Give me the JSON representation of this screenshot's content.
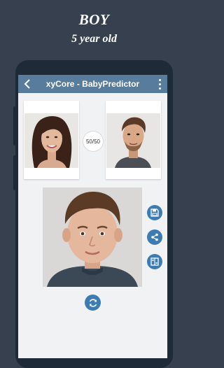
{
  "promo": {
    "title": "BOY",
    "subtitle": "5 year old"
  },
  "app_bar": {
    "title": "xyCore - BabyPredictor",
    "back_icon": "arrow-back-icon",
    "menu_icon": "more-vertical-icon",
    "color": "#587d9c"
  },
  "parents": {
    "mother_photo": "woman-portrait",
    "father_photo": "man-portrait",
    "compare_label": "50/50"
  },
  "result": {
    "child_photo": "boy-portrait"
  },
  "actions": {
    "save_icon": "save-icon",
    "share_icon": "share-icon",
    "compare_icon": "compare-icon",
    "regenerate_icon": "refresh-icon",
    "accent": "#3d7bb3"
  }
}
